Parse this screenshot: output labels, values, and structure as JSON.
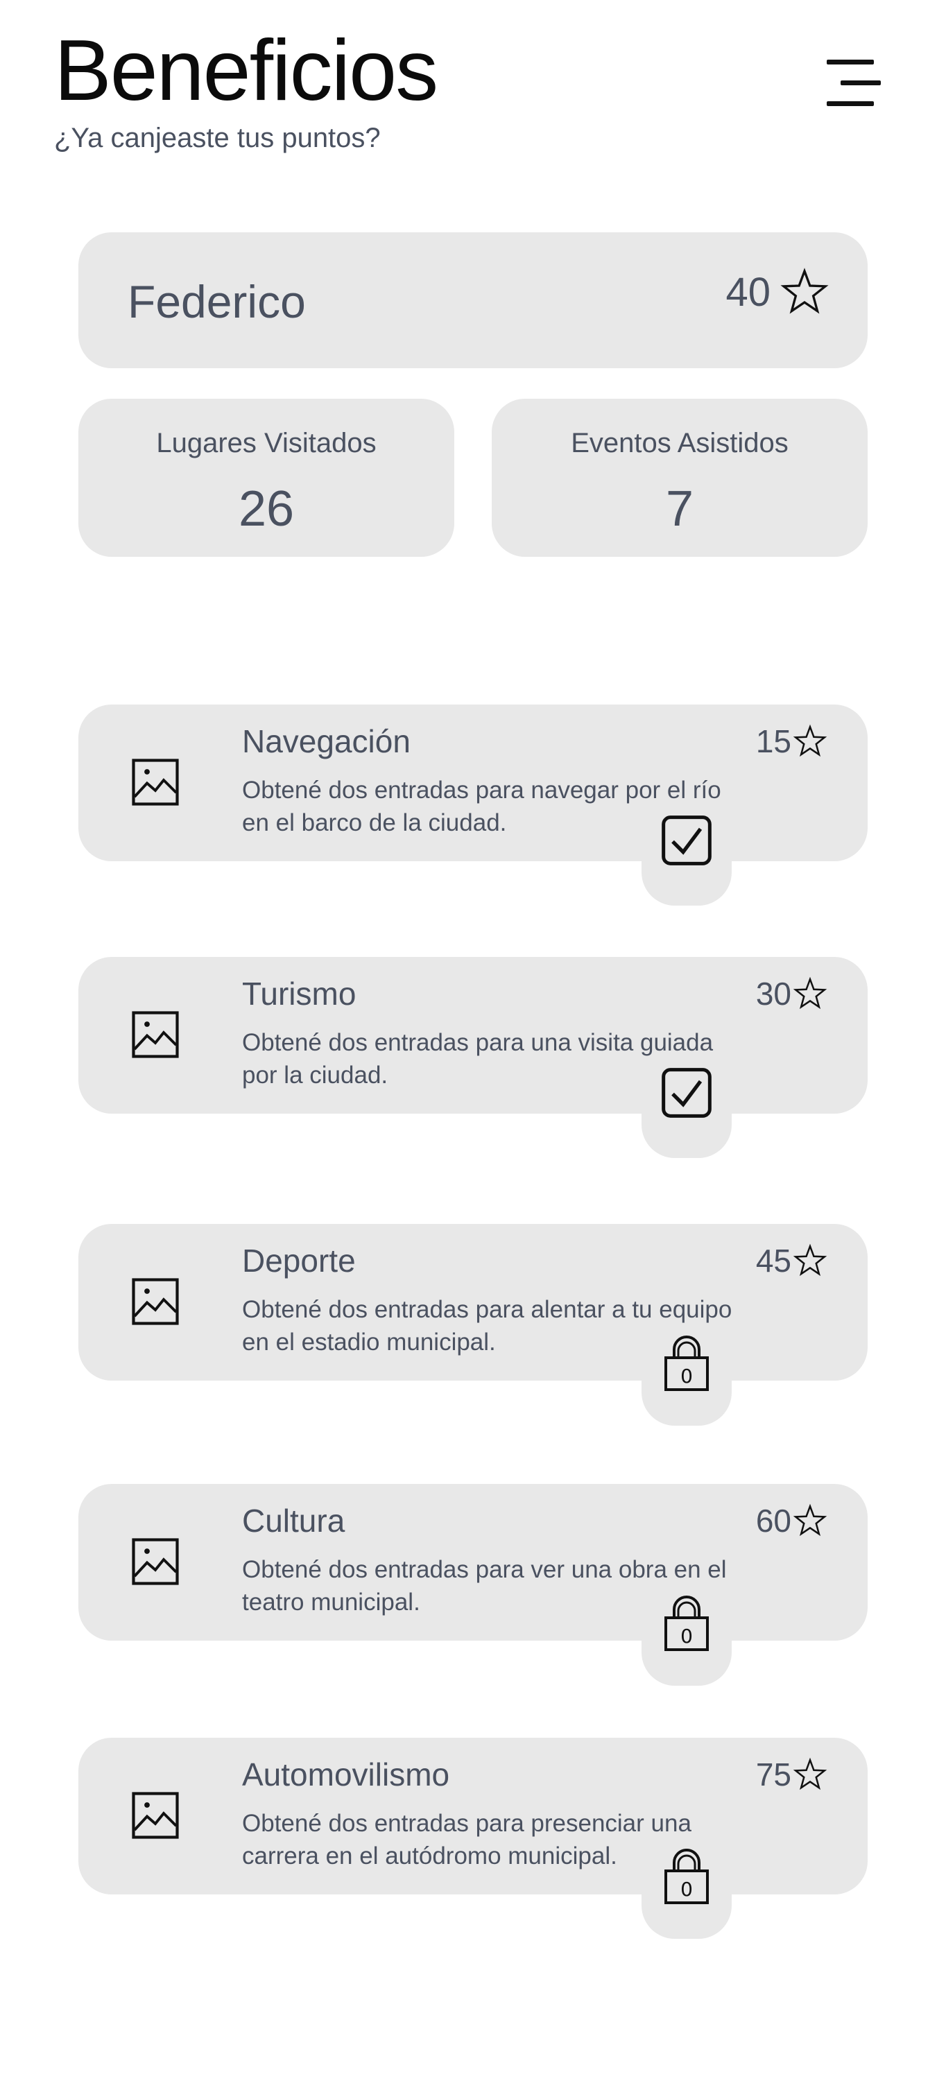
{
  "header": {
    "title": "Beneficios",
    "subtitle": "¿Ya canjeaste tus puntos?"
  },
  "user": {
    "name": "Federico",
    "points": "40"
  },
  "stats": [
    {
      "label": "Lugares Visitados",
      "value": "26"
    },
    {
      "label": "Eventos Asistidos",
      "value": "7"
    }
  ],
  "benefits": [
    {
      "name": "Navegación",
      "points": "15",
      "description": "Obtené dos entradas para navegar por el río en el barco de la ciudad.",
      "status": "redeemed",
      "status_icon": "checkbox-checked-icon"
    },
    {
      "name": "Turismo",
      "points": "30",
      "description": "Obtené dos entradas para una visita guiada por la ciudad.",
      "status": "redeemed",
      "status_icon": "checkbox-checked-icon"
    },
    {
      "name": "Deporte",
      "points": "45",
      "description": "Obtené dos entradas para alentar a tu equipo en el estadio municipal.",
      "status": "locked",
      "status_icon": "padlock-icon",
      "lock_code": "0"
    },
    {
      "name": "Cultura",
      "points": "60",
      "description": "Obtené dos entradas para ver una obra en el teatro municipal.",
      "status": "locked",
      "status_icon": "padlock-icon",
      "lock_code": "0"
    },
    {
      "name": "Automovilismo",
      "points": "75",
      "description": "Obtené dos entradas para presenciar una carrera en el autódromo municipal.",
      "status": "locked",
      "status_icon": "padlock-icon",
      "lock_code": "0"
    }
  ],
  "icons": {
    "menu": "menu-icon",
    "points": "star-outline-icon",
    "benefit_image": "image-placeholder-icon"
  },
  "colors": {
    "card_background": "#e8e8e8",
    "text_secondary": "#4a5160",
    "title": "#0b0b0b"
  }
}
